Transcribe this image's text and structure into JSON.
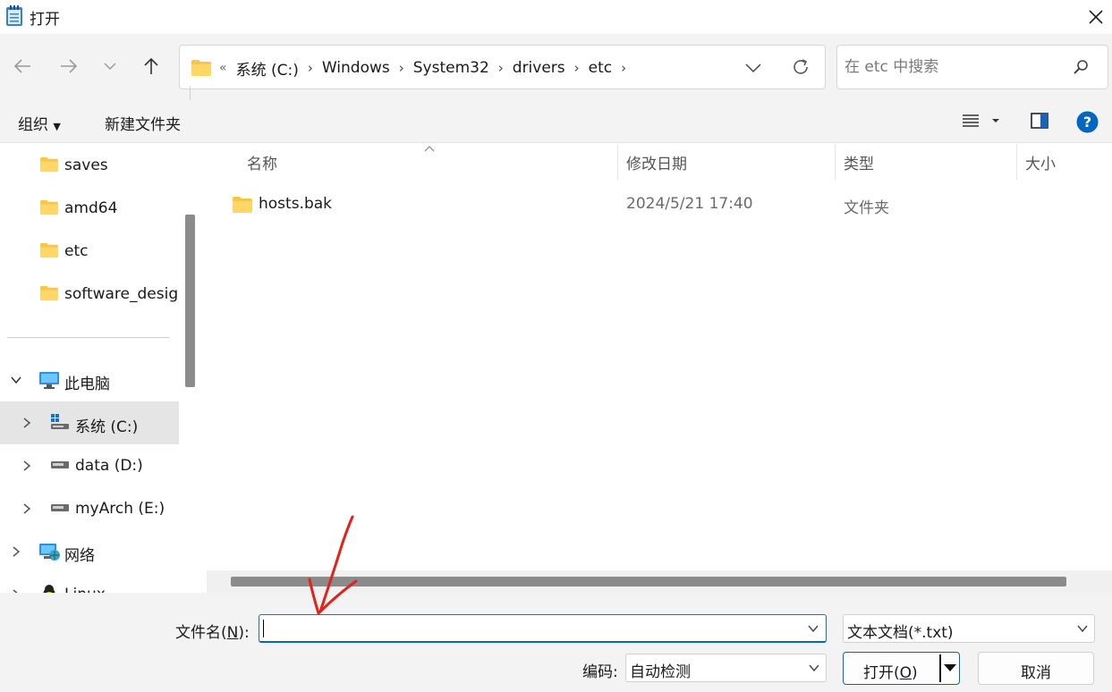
{
  "window": {
    "title": "打开"
  },
  "address": {
    "overflow": "«",
    "crumbs": [
      "系统 (C:)",
      "Windows",
      "System32",
      "drivers",
      "etc"
    ]
  },
  "search": {
    "placeholder": "在 etc 中搜索"
  },
  "toolbar": {
    "organize": "组织",
    "new_folder": "新建文件夹"
  },
  "sidebar": {
    "items": [
      {
        "label": "saves"
      },
      {
        "label": "amd64"
      },
      {
        "label": "etc"
      },
      {
        "label": "software_desig"
      },
      {
        "label": "此电脑"
      },
      {
        "label": "系统 (C:)"
      },
      {
        "label": "data (D:)"
      },
      {
        "label": "myArch (E:)"
      },
      {
        "label": "网络"
      },
      {
        "label": "Linux"
      }
    ]
  },
  "columns": {
    "name": "名称",
    "modified": "修改日期",
    "type": "类型",
    "size": "大小"
  },
  "files": [
    {
      "name": "hosts.bak",
      "modified": "2024/5/21 17:40",
      "type": "文件夹"
    }
  ],
  "bottom": {
    "filename_label_pre": "文件名(",
    "filename_label_key": "N",
    "filename_label_post": "):",
    "filename_value": "",
    "filetype_value": "文本文档(*.txt)",
    "encoding_label": "编码:",
    "encoding_value": "自动检测",
    "open_pre": "打开(",
    "open_key": "O",
    "open_post": ")",
    "cancel": "取消"
  },
  "colors": {
    "accent": "#0067c0",
    "folder": "#f8c545",
    "annotation": "#e0231b"
  }
}
